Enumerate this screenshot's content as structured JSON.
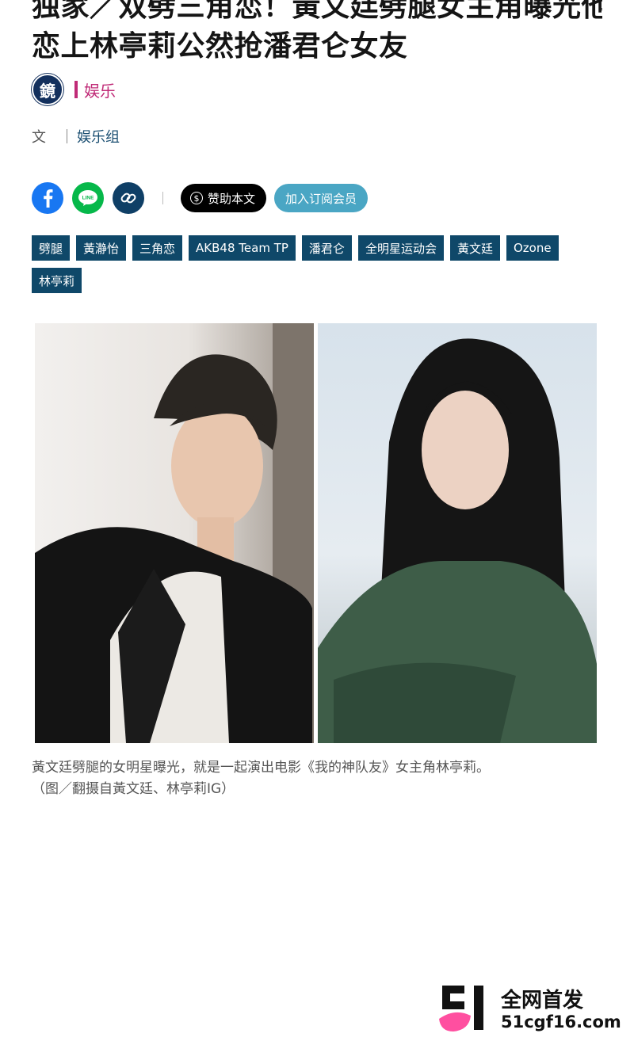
{
  "article": {
    "title_line1": "独家／双劈三角恋！黃文廷劈腿女主角曝光他",
    "title_line2": "恋上林亭莉公然抢潘君仑女友",
    "brand": {
      "logo_text": "鏡",
      "category": "娱乐"
    },
    "author": {
      "prefix": "文",
      "name": "娱乐组"
    },
    "share": {
      "facebook_icon": "facebook-icon",
      "line_icon": "line-icon",
      "line_label": "LINE",
      "link_icon": "link-icon",
      "sponsor_label": "赞助本文",
      "member_label": "加入订阅会员"
    },
    "tags": [
      "劈腿",
      "黃瀞怡",
      "三角恋",
      "AKB48 Team TP",
      "潘君仑",
      "全明星运动会",
      "黃文廷",
      "Ozone",
      "林亭莉"
    ],
    "caption_line1": "黃文廷劈腿的女明星曝光，就是一起演出电影《我的神队友》女主角林亭莉。",
    "caption_line2": "（图／翻摄自黃文廷、林亭莉IG）"
  },
  "watermark": {
    "line1": "全网首发",
    "line2": "51cgf16.com"
  },
  "colors": {
    "brand_pink": "#c02b77",
    "tag_bg": "#0f4869",
    "facebook": "#1877f2",
    "line": "#06b84a",
    "member_button": "#4aa6c4"
  }
}
